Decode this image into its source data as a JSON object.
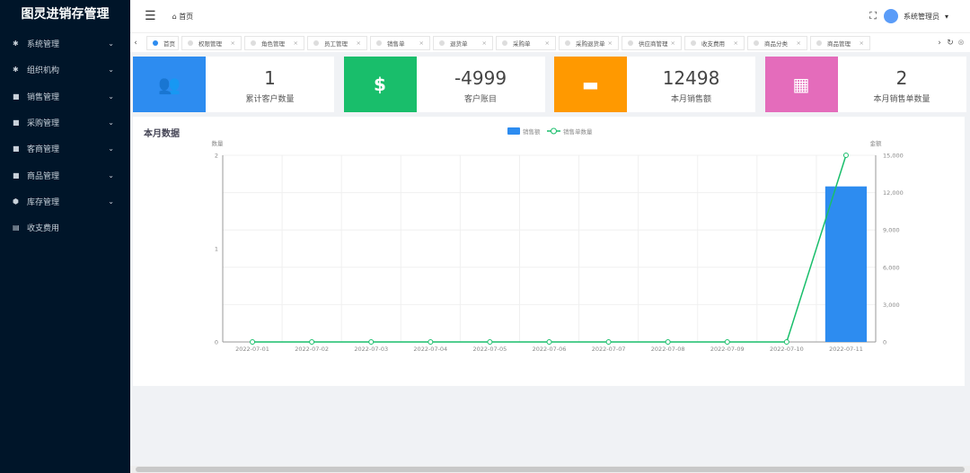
{
  "app_title": "图灵进销存管理",
  "sidebar": {
    "items": [
      {
        "label": "系统管理",
        "icon": "gear-icon"
      },
      {
        "label": "组织机构",
        "icon": "gear-icon"
      },
      {
        "label": "销售管理",
        "icon": "folder-icon"
      },
      {
        "label": "采购管理",
        "icon": "folder-icon"
      },
      {
        "label": "客商管理",
        "icon": "folder-icon"
      },
      {
        "label": "商品管理",
        "icon": "folder-icon"
      },
      {
        "label": "库存管理",
        "icon": "cube-icon"
      },
      {
        "label": "收支费用",
        "icon": "ledger-icon"
      }
    ]
  },
  "header": {
    "breadcrumb": "首页",
    "user": "系统管理员"
  },
  "tabs": [
    "首页",
    "权限管理",
    "角色管理",
    "员工管理",
    "销售单",
    "退货单",
    "采购单",
    "采购退货单",
    "供应商管理",
    "收支费用",
    "商品分类",
    "商品管理"
  ],
  "cards": [
    {
      "value": "1",
      "label": "累计客户数量",
      "color": "#2d8cf0",
      "icon": "users-icon"
    },
    {
      "value": "-4999",
      "label": "客户账目",
      "color": "#19be6b",
      "icon": "dollar-icon"
    },
    {
      "value": "12498",
      "label": "本月销售额",
      "color": "#ff9900",
      "icon": "money-icon"
    },
    {
      "value": "2",
      "label": "本月销售单数量",
      "color": "#e46cbb",
      "icon": "newspaper-icon"
    }
  ],
  "panel_title": "本月数据",
  "chart_data": {
    "type": "bar+line",
    "categories": [
      "2022-07-01",
      "2022-07-02",
      "2022-07-03",
      "2022-07-04",
      "2022-07-05",
      "2022-07-06",
      "2022-07-07",
      "2022-07-08",
      "2022-07-09",
      "2022-07-10",
      "2022-07-11"
    ],
    "series": [
      {
        "name": "销售额",
        "type": "bar",
        "axis": "right",
        "color": "#2d8cf0",
        "values": [
          0,
          0,
          0,
          0,
          0,
          0,
          0,
          0,
          0,
          0,
          12498
        ]
      },
      {
        "name": "销售单数量",
        "type": "line",
        "axis": "left",
        "color": "#19be6b",
        "values": [
          0,
          0,
          0,
          0,
          0,
          0,
          0,
          0,
          0,
          0,
          2
        ]
      }
    ],
    "left_axis": {
      "label": "数量",
      "range": [
        0,
        2
      ],
      "ticks": [
        "0",
        "1",
        "2"
      ]
    },
    "right_axis": {
      "label": "金额",
      "range": [
        0,
        15000
      ],
      "ticks": [
        "0",
        "3,000",
        "6,000",
        "9,000",
        "12,000",
        "15,000"
      ]
    },
    "legend": "top-center",
    "grid": true
  }
}
